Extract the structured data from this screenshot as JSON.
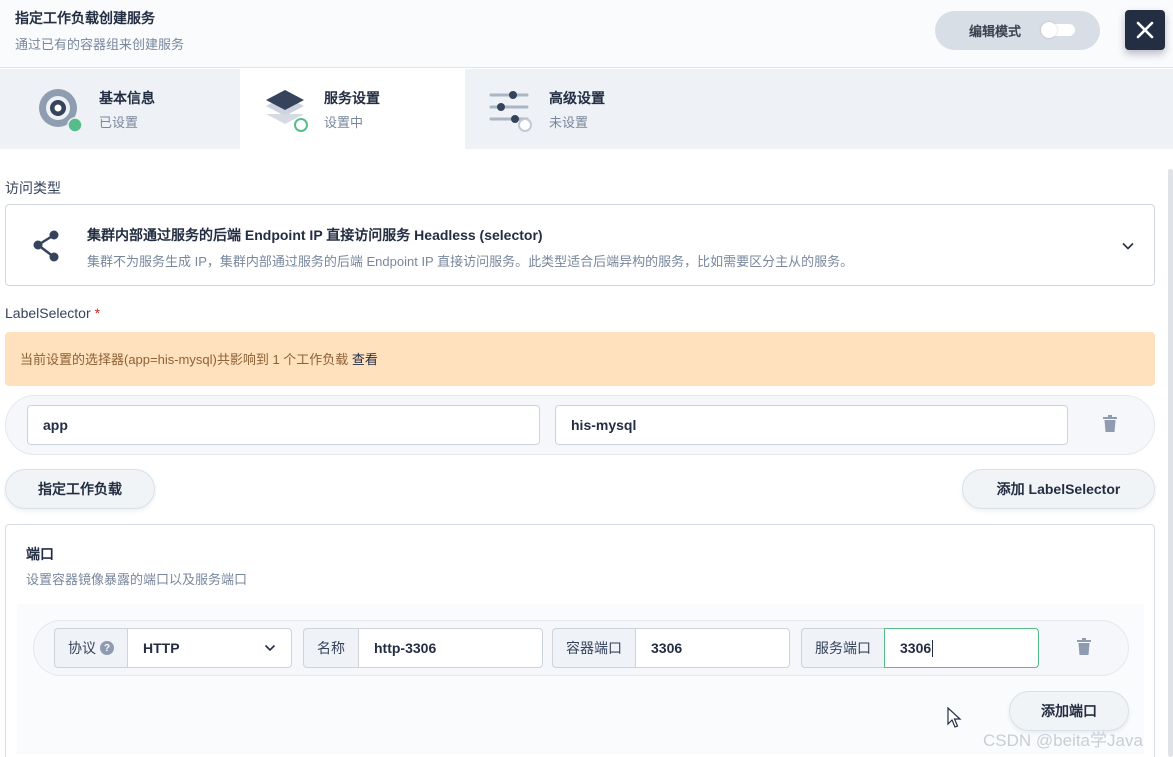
{
  "header": {
    "title": "指定工作负载创建服务",
    "subtitle": "通过已有的容器组来创建服务",
    "edit_mode_label": "编辑模式",
    "close_icon": "close-icon"
  },
  "steps": [
    {
      "name": "基本信息",
      "state": "已设置",
      "icon": "info-icon"
    },
    {
      "name": "服务设置",
      "state": "设置中",
      "icon": "service-layers-icon"
    },
    {
      "name": "高级设置",
      "state": "未设置",
      "icon": "sliders-icon"
    }
  ],
  "access": {
    "label": "访问类型",
    "selected_title": "集群内部通过服务的后端 Endpoint IP 直接访问服务 Headless (selector)",
    "selected_desc": "集群不为服务生成 IP，集群内部通过服务的后端 Endpoint IP 直接访问服务。此类型适合后端异构的服务，比如需要区分主从的服务。"
  },
  "label_selector": {
    "label": "LabelSelector",
    "required_mark": "*",
    "notice": "当前设置的选择器(app=his-mysql)共影响到 1 个工作负载",
    "notice_link": "查看",
    "key": "app",
    "value": "his-mysql",
    "specify_workload_button": "指定工作负载",
    "add_button": "添加 LabelSelector"
  },
  "ports": {
    "title": "端口",
    "description": "设置容器镜像暴露的端口以及服务端口",
    "protocol_label": "协议",
    "protocol_help": "?",
    "protocol_value": "HTTP",
    "name_label": "名称",
    "name_value": "http-3306",
    "container_port_label": "容器端口",
    "container_port_value": "3306",
    "service_port_label": "服务端口",
    "service_port_value": "3306",
    "add_port_button": "添加端口"
  },
  "watermark": "CSDN @beita学Java",
  "colors": {
    "primary_dark": "#242e42",
    "success": "#55bc8a",
    "warning_bg": "#ffe1be"
  }
}
